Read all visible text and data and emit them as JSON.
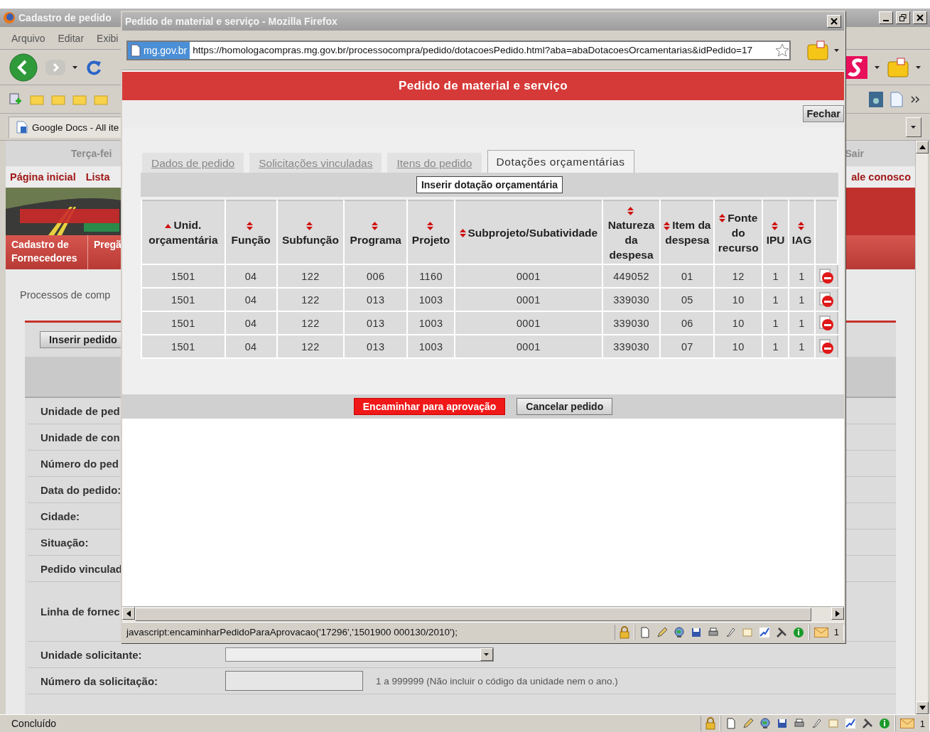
{
  "main_window": {
    "title": "Cadastro de pedido",
    "menu": [
      "Arquivo",
      "Editar",
      "Exibi"
    ],
    "bookmark_tab": "Google Docs - All ite",
    "date_text": "Terça-fei",
    "logout": "Sair",
    "links": [
      "Página inicial",
      "Lista"
    ],
    "contact_link": "ale conosco",
    "nav_items": [
      "Cadastro de Fornecedores",
      "Pregã"
    ],
    "section_title": "Processos de comp",
    "insert_button": "Inserir pedido",
    "form_rows": [
      {
        "label": "Unidade de ped",
        "kind": "text"
      },
      {
        "label": "Unidade de con",
        "kind": "text"
      },
      {
        "label": "Número do ped",
        "kind": "text"
      },
      {
        "label": "Data do pedido:",
        "kind": "text"
      },
      {
        "label": "Cidade:",
        "kind": "text"
      },
      {
        "label": "Situação:",
        "kind": "text"
      },
      {
        "label": "Pedido vinculad",
        "kind": "text"
      },
      {
        "label": "Linha de fornec",
        "kind": "list"
      },
      {
        "label": "Unidade solicitante:",
        "kind": "select"
      },
      {
        "label": "Número da solicitação:",
        "kind": "input",
        "hint": "1 a 999999 (Não incluir o código da unidade nem o ano.)"
      }
    ],
    "status": "Concluído",
    "mail_count": "1"
  },
  "popup": {
    "title": "Pedido de material e serviço - Mozilla Firefox",
    "site_badge": "mg.gov.br",
    "url": "https://homologacompras.mg.gov.br/processocompra/pedido/dotacoesPedido.html?aba=abaDotacoesOrcamentarias&idPedido=17",
    "header": "Pedido de material e serviço",
    "close_button": "Fechar",
    "tabs": [
      {
        "label": "Dados de pedido",
        "selected": false
      },
      {
        "label": "Solicitações vinculadas",
        "selected": false
      },
      {
        "label": "Itens do pedido",
        "selected": false
      },
      {
        "label": "Dotações orçamentárias",
        "selected": true
      }
    ],
    "insert_button": "Inserir dotação orçamentária",
    "table": {
      "columns": [
        {
          "label": "Unid. orçamentária",
          "sorted": true
        },
        {
          "label": "Função",
          "sorted": false
        },
        {
          "label": "Subfunção",
          "sorted": false
        },
        {
          "label": "Programa",
          "sorted": false
        },
        {
          "label": "Projeto",
          "sorted": false
        },
        {
          "label": "Subprojeto/Subatividade",
          "sorted": false
        },
        {
          "label": "Natureza da despesa",
          "sorted": false
        },
        {
          "label": "Item da despesa",
          "sorted": false
        },
        {
          "label": "Fonte do recurso",
          "sorted": false
        },
        {
          "label": "IPU",
          "sorted": false
        },
        {
          "label": "IAG",
          "sorted": false
        }
      ],
      "rows": [
        [
          "1501",
          "04",
          "122",
          "006",
          "1160",
          "0001",
          "449052",
          "01",
          "12",
          "1",
          "1"
        ],
        [
          "1501",
          "04",
          "122",
          "013",
          "1003",
          "0001",
          "339030",
          "05",
          "10",
          "1",
          "1"
        ],
        [
          "1501",
          "04",
          "122",
          "013",
          "1003",
          "0001",
          "339030",
          "06",
          "10",
          "1",
          "1"
        ],
        [
          "1501",
          "04",
          "122",
          "013",
          "1003",
          "0001",
          "339030",
          "07",
          "10",
          "1",
          "1"
        ]
      ]
    },
    "actions": [
      {
        "label": "Encaminhar para aprovação",
        "kind": "primary"
      },
      {
        "label": "Cancelar pedido",
        "kind": "secondary"
      }
    ],
    "status_text": "javascript:encaminharPedidoParaAprovacao('17296','1501900 000130/2010');",
    "mail_count": "1"
  }
}
